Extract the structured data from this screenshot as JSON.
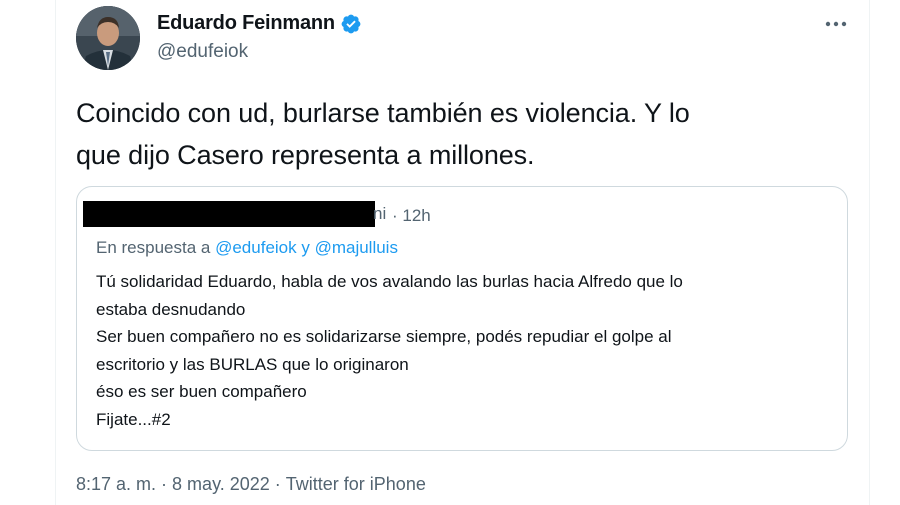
{
  "tweet": {
    "author": {
      "display_name": "Eduardo Feinmann",
      "handle": "@edufeiok",
      "verified": true,
      "avatar_icon": "profile-photo"
    },
    "more_icon": "more-horizontal-icon",
    "text_lines": [
      "Coincido con ud, burlarse también es violencia. Y lo",
      "que dijo Casero representa a millones."
    ],
    "quoted": {
      "name_tail": "ni",
      "time": "· 12h",
      "reply_prefix": "En respuesta a",
      "reply_mentions": "@edufeiok y @majulluis",
      "body_lines": [
        "Tú solidaridad Eduardo, habla de vos avalando las burlas hacia Alfredo que lo",
        "estaba desnudando",
        "Ser buen compañero no es solidarizarse siempre, podés repudiar el golpe al",
        "escritorio y las BURLAS que lo originaron",
        "éso es ser buen compañero",
        "Fijate...#2"
      ]
    },
    "meta": {
      "time": "8:17 a. m.",
      "separator": "·",
      "date": "8 may. 2022",
      "source": "Twitter for iPhone"
    }
  },
  "colors": {
    "text_primary": "#0f1419",
    "text_secondary": "#536471",
    "link": "#1d9bf0",
    "border": "#cfd9de",
    "verified": "#1d9bf0"
  }
}
